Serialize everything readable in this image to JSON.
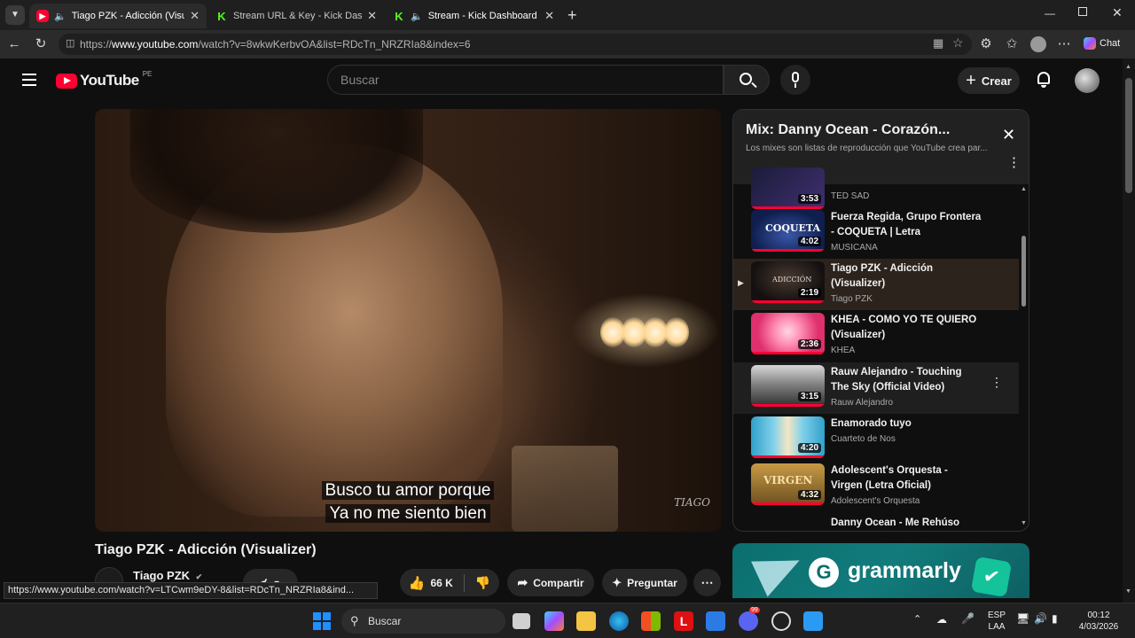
{
  "browser": {
    "tabs": [
      {
        "title": "Tiago PZK - Adicción (Visualiz",
        "favicon": "youtube-icon",
        "audio": true,
        "active": true
      },
      {
        "title": "Stream URL & Key - Kick Dashboa",
        "favicon": "kick-icon",
        "audio": false,
        "active": false
      },
      {
        "title": "Stream - Kick Dashboard",
        "favicon": "kick-icon",
        "audio": true,
        "active": false
      }
    ],
    "url_prefix": "https://",
    "url_host": "www.youtube.com",
    "url_path": "/watch?v=8wkwKerbvOA&list=RDcTn_NRZRIa8&index=6",
    "copilot_label": "Chat"
  },
  "youtube": {
    "logo_text": "YouTube",
    "country_code": "PE",
    "search_placeholder": "Buscar",
    "create_label": "Crear"
  },
  "video": {
    "subtitle_line1": "Busco tu amor porque",
    "subtitle_line2": "Ya no me siento bien",
    "watermark": "TIAGO",
    "title": "Tiago PZK - Adicción (Visualizer)",
    "channel": "Tiago PZK",
    "likes": "66 K",
    "share_label": "Compartir",
    "ask_label": "Preguntar"
  },
  "status_url": "https://www.youtube.com/watch?v=LTCwm9eDY-8&list=RDcTn_NRZRIa8&ind...",
  "playlist": {
    "title": "Mix: Danny Ocean - Corazón...",
    "subtitle": "Los mixes son listas de reproducción que YouTube crea par...",
    "items": [
      {
        "title": "",
        "channel": "TED SAD",
        "duration": "3:53"
      },
      {
        "title": "Fuerza Regida, Grupo Frontera - COQUETA | Letra",
        "channel": "MUSICANA",
        "duration": "4:02"
      },
      {
        "title": "Tiago PZK - Adicción (Visualizer)",
        "channel": "Tiago PZK",
        "duration": "2:19"
      },
      {
        "title": "KHEA - COMO YO TE QUIERO (Visualizer)",
        "channel": "KHEA",
        "duration": "2:36"
      },
      {
        "title": "Rauw Alejandro - Touching The Sky (Official Video)",
        "channel": "Rauw Alejandro",
        "duration": "3:15"
      },
      {
        "title": "Enamorado tuyo",
        "channel": "Cuarteto de Nos",
        "duration": "4:20"
      },
      {
        "title": "Adolescent's Orquesta - Virgen (Letra Oficial)",
        "channel": "Adolescent's Orquesta",
        "duration": "4:32"
      },
      {
        "title": "Danny Ocean - Me Rehúso",
        "channel": "",
        "duration": ""
      }
    ]
  },
  "ad": {
    "brand": "grammarly"
  },
  "taskbar": {
    "search_placeholder": "Buscar",
    "lang_line1": "ESP",
    "lang_line2": "LAA",
    "time": "00:12",
    "date": "4/03/2026",
    "notification_count": "99"
  },
  "colors": {
    "accent_red": "#ff0033",
    "kick_green": "#53fc18",
    "bg": "#0f0f0f"
  }
}
